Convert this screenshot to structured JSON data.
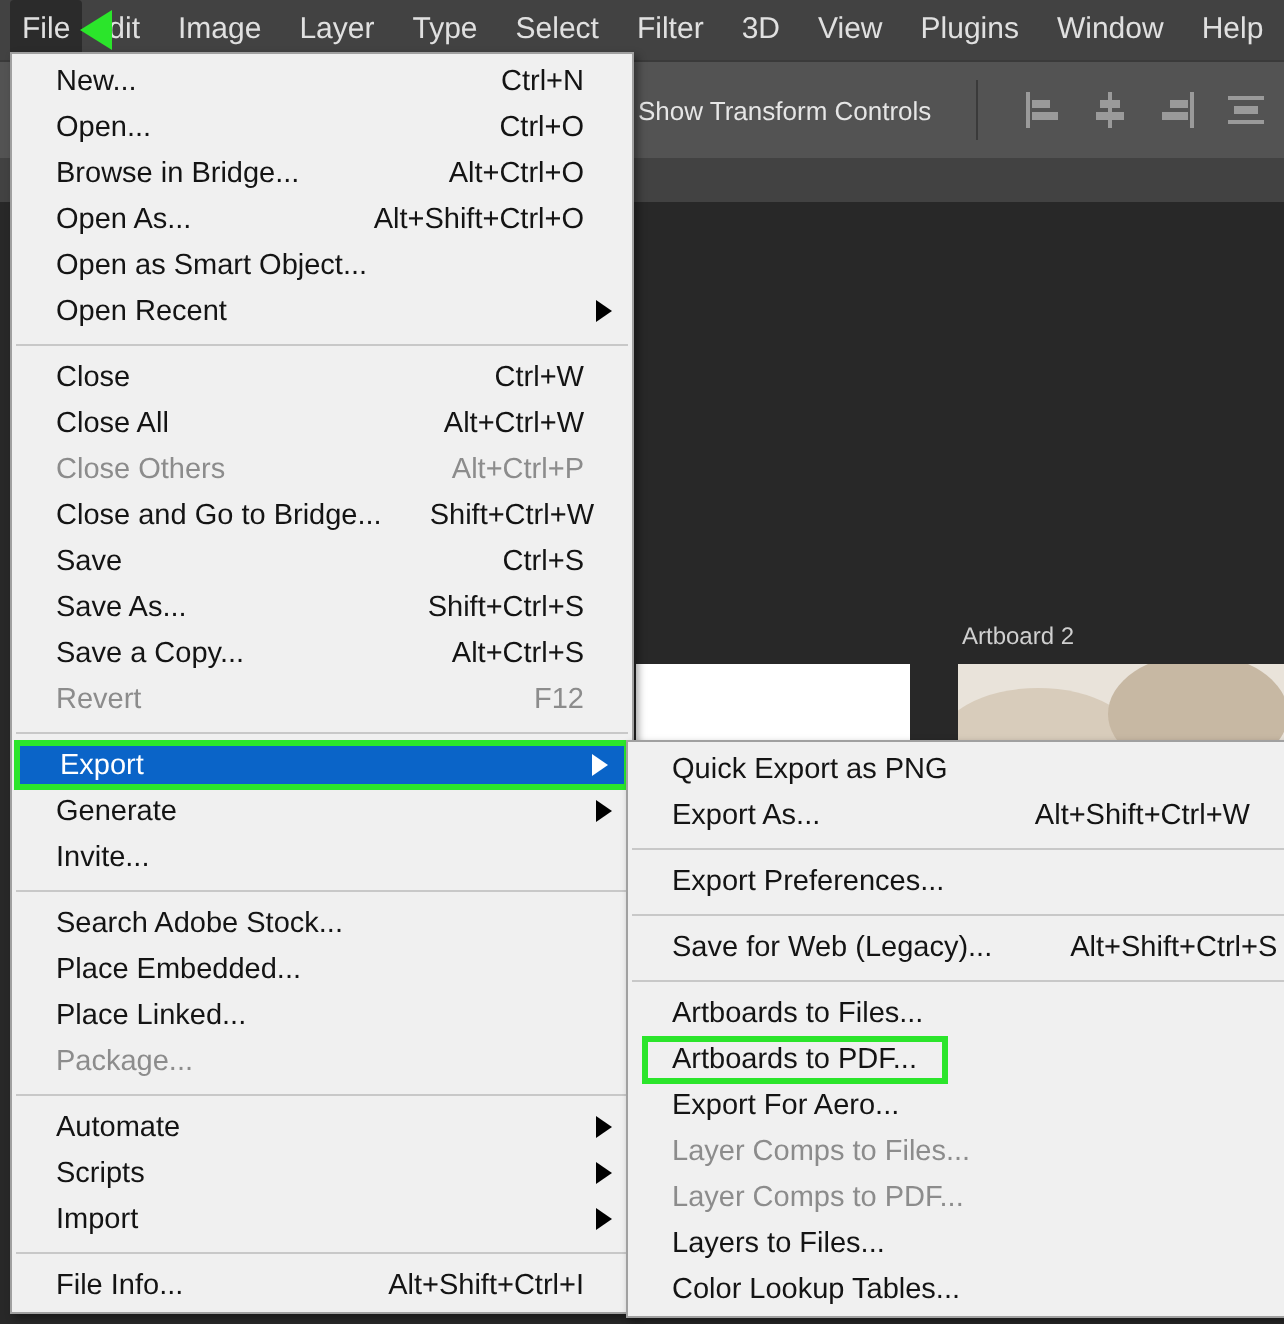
{
  "menu_bar": [
    {
      "label": "File",
      "selected": true
    },
    {
      "label": "dit",
      "selected": false
    },
    {
      "label": "Image",
      "selected": false
    },
    {
      "label": "Layer",
      "selected": false
    },
    {
      "label": "Type",
      "selected": false
    },
    {
      "label": "Select",
      "selected": false
    },
    {
      "label": "Filter",
      "selected": false
    },
    {
      "label": "3D",
      "selected": false
    },
    {
      "label": "View",
      "selected": false
    },
    {
      "label": "Plugins",
      "selected": false
    },
    {
      "label": "Window",
      "selected": false
    },
    {
      "label": "Help",
      "selected": false
    }
  ],
  "options_bar": {
    "label": "Show Transform Controls"
  },
  "canvas": {
    "artboard_title": "Artboard 2"
  },
  "file_menu": [
    {
      "kind": "item",
      "label": "New...",
      "shortcut": "Ctrl+N",
      "disabled": false,
      "submenu": false,
      "selected": false,
      "outlined": false
    },
    {
      "kind": "item",
      "label": "Open...",
      "shortcut": "Ctrl+O",
      "disabled": false,
      "submenu": false,
      "selected": false,
      "outlined": false
    },
    {
      "kind": "item",
      "label": "Browse in Bridge...",
      "shortcut": "Alt+Ctrl+O",
      "disabled": false,
      "submenu": false,
      "selected": false,
      "outlined": false
    },
    {
      "kind": "item",
      "label": "Open As...",
      "shortcut": "Alt+Shift+Ctrl+O",
      "disabled": false,
      "submenu": false,
      "selected": false,
      "outlined": false
    },
    {
      "kind": "item",
      "label": "Open as Smart Object...",
      "disabled": false,
      "submenu": false,
      "selected": false,
      "outlined": false
    },
    {
      "kind": "item",
      "label": "Open Recent",
      "disabled": false,
      "submenu": true,
      "selected": false,
      "outlined": false
    },
    {
      "kind": "separator"
    },
    {
      "kind": "item",
      "label": "Close",
      "shortcut": "Ctrl+W",
      "disabled": false,
      "submenu": false,
      "selected": false,
      "outlined": false
    },
    {
      "kind": "item",
      "label": "Close All",
      "shortcut": "Alt+Ctrl+W",
      "disabled": false,
      "submenu": false,
      "selected": false,
      "outlined": false
    },
    {
      "kind": "item",
      "label": "Close Others",
      "shortcut": "Alt+Ctrl+P",
      "disabled": true,
      "submenu": false,
      "selected": false,
      "outlined": false
    },
    {
      "kind": "item",
      "label": "Close and Go to Bridge...",
      "shortcut": "Shift+Ctrl+W",
      "disabled": false,
      "submenu": false,
      "selected": false,
      "outlined": false
    },
    {
      "kind": "item",
      "label": "Save",
      "shortcut": "Ctrl+S",
      "disabled": false,
      "submenu": false,
      "selected": false,
      "outlined": false
    },
    {
      "kind": "item",
      "label": "Save As...",
      "shortcut": "Shift+Ctrl+S",
      "disabled": false,
      "submenu": false,
      "selected": false,
      "outlined": false
    },
    {
      "kind": "item",
      "label": "Save a Copy...",
      "shortcut": "Alt+Ctrl+S",
      "disabled": false,
      "submenu": false,
      "selected": false,
      "outlined": false
    },
    {
      "kind": "item",
      "label": "Revert",
      "shortcut": "F12",
      "disabled": true,
      "submenu": false,
      "selected": false,
      "outlined": false
    },
    {
      "kind": "separator"
    },
    {
      "kind": "item",
      "label": "Export",
      "disabled": false,
      "submenu": true,
      "selected": true,
      "outlined": true
    },
    {
      "kind": "item",
      "label": "Generate",
      "disabled": false,
      "submenu": true,
      "selected": false,
      "outlined": false
    },
    {
      "kind": "item",
      "label": "Invite...",
      "disabled": false,
      "submenu": false,
      "selected": false,
      "outlined": false
    },
    {
      "kind": "separator"
    },
    {
      "kind": "item",
      "label": "Search Adobe Stock...",
      "disabled": false,
      "submenu": false,
      "selected": false,
      "outlined": false
    },
    {
      "kind": "item",
      "label": "Place Embedded...",
      "disabled": false,
      "submenu": false,
      "selected": false,
      "outlined": false
    },
    {
      "kind": "item",
      "label": "Place Linked...",
      "disabled": false,
      "submenu": false,
      "selected": false,
      "outlined": false
    },
    {
      "kind": "item",
      "label": "Package...",
      "disabled": true,
      "submenu": false,
      "selected": false,
      "outlined": false
    },
    {
      "kind": "separator"
    },
    {
      "kind": "item",
      "label": "Automate",
      "disabled": false,
      "submenu": true,
      "selected": false,
      "outlined": false
    },
    {
      "kind": "item",
      "label": "Scripts",
      "disabled": false,
      "submenu": true,
      "selected": false,
      "outlined": false
    },
    {
      "kind": "item",
      "label": "Import",
      "disabled": false,
      "submenu": true,
      "selected": false,
      "outlined": false
    },
    {
      "kind": "separator"
    },
    {
      "kind": "item",
      "label": "File Info...",
      "shortcut": "Alt+Shift+Ctrl+I",
      "disabled": false,
      "submenu": false,
      "selected": false,
      "outlined": false
    }
  ],
  "export_menu": [
    {
      "kind": "item",
      "label": "Quick Export as PNG",
      "disabled": false,
      "outlined": false
    },
    {
      "kind": "item",
      "label": "Export As...",
      "shortcut": "Alt+Shift+Ctrl+W",
      "disabled": false,
      "outlined": false
    },
    {
      "kind": "separator"
    },
    {
      "kind": "item",
      "label": "Export Preferences...",
      "disabled": false,
      "outlined": false
    },
    {
      "kind": "separator"
    },
    {
      "kind": "item",
      "label": "Save for Web (Legacy)...",
      "shortcut": "Alt+Shift+Ctrl+S",
      "disabled": false,
      "outlined": false
    },
    {
      "kind": "separator"
    },
    {
      "kind": "item",
      "label": "Artboards to Files...",
      "disabled": false,
      "outlined": false
    },
    {
      "kind": "item",
      "label": "Artboards to PDF...",
      "disabled": false,
      "outlined": true
    },
    {
      "kind": "item",
      "label": "Export For Aero...",
      "disabled": false,
      "outlined": false
    },
    {
      "kind": "item",
      "label": "Layer Comps to Files...",
      "disabled": true,
      "outlined": false
    },
    {
      "kind": "item",
      "label": "Layer Comps to PDF...",
      "disabled": true,
      "outlined": false
    },
    {
      "kind": "item",
      "label": "Layers to Files...",
      "disabled": false,
      "outlined": false
    },
    {
      "kind": "item",
      "label": "Color Lookup Tables...",
      "disabled": false,
      "outlined": false
    }
  ]
}
